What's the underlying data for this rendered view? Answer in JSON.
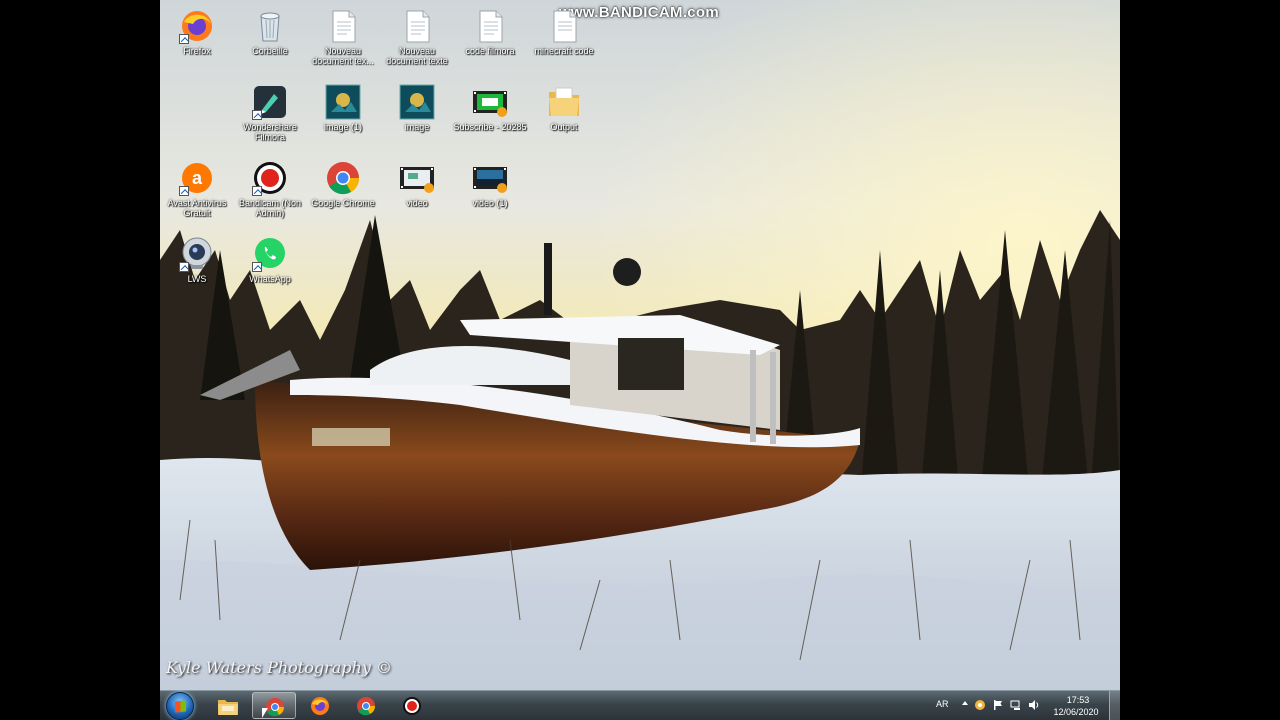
{
  "watermark": "www.BANDICAM.com",
  "photo_credit": "Kyle Waters Photography ©",
  "desktop_icons": [
    {
      "label": "Firefox",
      "icon": "firefox-icon"
    },
    {
      "label": "Corbeille",
      "icon": "recycle-bin-icon"
    },
    {
      "label": "Nouveau document tex...",
      "icon": "text-document-icon"
    },
    {
      "label": "Nouveau document texte",
      "icon": "text-document-icon"
    },
    {
      "label": "code filmora",
      "icon": "text-document-icon"
    },
    {
      "label": "minecraft code",
      "icon": "text-document-icon"
    },
    {
      "label": "Wondershare Filmora",
      "icon": "filmora-icon"
    },
    {
      "label": "image (1)",
      "icon": "image-icon"
    },
    {
      "label": "image",
      "icon": "image-icon"
    },
    {
      "label": "Subscribe - 20285",
      "icon": "video-file-icon"
    },
    {
      "label": "Output",
      "icon": "folder-icon"
    },
    {
      "label": "Avast Antivirus Gratuit",
      "icon": "avast-icon"
    },
    {
      "label": "Bandicam (Non Admin)",
      "icon": "bandicam-icon"
    },
    {
      "label": "Google Chrome",
      "icon": "chrome-icon"
    },
    {
      "label": "video",
      "icon": "video-file-icon"
    },
    {
      "label": "video (1)",
      "icon": "video-file-icon"
    },
    {
      "label": "LWS",
      "icon": "webcam-icon"
    },
    {
      "label": "WhatsApp",
      "icon": "whatsapp-icon"
    }
  ],
  "taskbar": {
    "items": [
      {
        "icon": "file-explorer-icon"
      },
      {
        "icon": "chrome-icon",
        "active": true
      },
      {
        "icon": "firefox-icon"
      },
      {
        "icon": "chrome-icon"
      },
      {
        "icon": "bandicam-icon"
      }
    ],
    "language": "AR",
    "time": "17:53",
    "date": "12/06/2020"
  }
}
